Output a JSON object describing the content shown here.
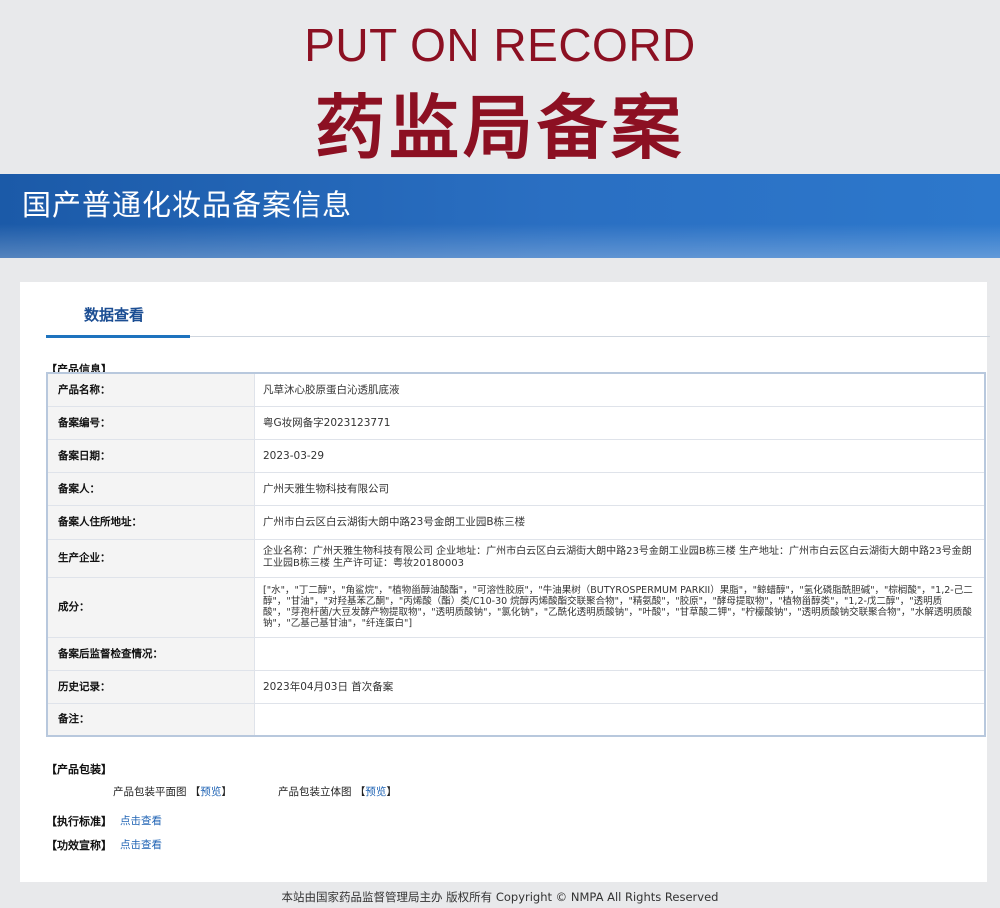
{
  "hero": {
    "title_en": "PUT ON RECORD",
    "title_cn": "药监局备案"
  },
  "banner": {
    "title": "国产普通化妆品备案信息"
  },
  "tab": {
    "label": "数据查看"
  },
  "sections": {
    "product_info": "【产品信息】",
    "product_packaging": "【产品包装】",
    "standard": "【执行标准】",
    "efficacy": "【功效宣称】"
  },
  "rows": [
    {
      "label": "产品名称：",
      "value": "凡草沐心胶原蛋白沁透肌底液"
    },
    {
      "label": "备案编号：",
      "value": "粤G妆网备字2023123771"
    },
    {
      "label": "备案日期：",
      "value": "2023-03-29"
    },
    {
      "label": "备案人：",
      "value": "广州天雅生物科技有限公司"
    },
    {
      "label": "备案人住所地址：",
      "value": "广州市白云区白云湖街大朗中路23号金朗工业园B栋三楼"
    },
    {
      "label": "生产企业：",
      "value": "企业名称：广州天雅生物科技有限公司 企业地址：广州市白云区白云湖街大朗中路23号金朗工业园B栋三楼 生产地址：广州市白云区白云湖街大朗中路23号金朗工业园B栋三楼 生产许可证：粤妆20180003"
    },
    {
      "label": "成分：",
      "value": "[\"水\"，\"丁二醇\"，\"角鲨烷\"，\"植物甾醇油酸酯\"，\"可溶性胶原\"，\"牛油果树（BUTYROSPERMUM PARKII）果脂\"，\"鲸蜡醇\"，\"氢化磷脂酰胆碱\"，\"棕榈酸\"，\"1,2-己二醇\"，\"甘油\"，\"对羟基苯乙酮\"，\"丙烯酸（酯）类/C10-30 烷醇丙烯酸酯交联聚合物\"，\"精氨酸\"，\"胶原\"，\"酵母提取物\"，\"植物甾醇类\"，\"1,2-戊二醇\"，\"透明质酸\"，\"芽孢杆菌/大豆发酵产物提取物\"，\"透明质酸钠\"，\"氯化钠\"，\"乙酰化透明质酸钠\"，\"叶酸\"，\"甘草酸二钾\"，\"柠檬酸钠\"，\"透明质酸钠交联聚合物\"，\"水解透明质酸钠\"，\"乙基己基甘油\"，\"纤连蛋白\"]"
    },
    {
      "label": "备案后监督检查情况：",
      "value": ""
    },
    {
      "label": "历史记录：",
      "value": "2023年04月03日 首次备案"
    },
    {
      "label": "备注：",
      "value": ""
    }
  ],
  "packaging": {
    "flat_label": "产品包装平面图",
    "solid_label": "产品包装立体图",
    "bracket_open": "【",
    "bracket_close": "】",
    "preview_link": "预览"
  },
  "links": {
    "click_view": "点击查看"
  },
  "footer": {
    "text": "本站由国家药品监督管理局主办 版权所有 Copyright © NMPA All Rights Reserved"
  }
}
